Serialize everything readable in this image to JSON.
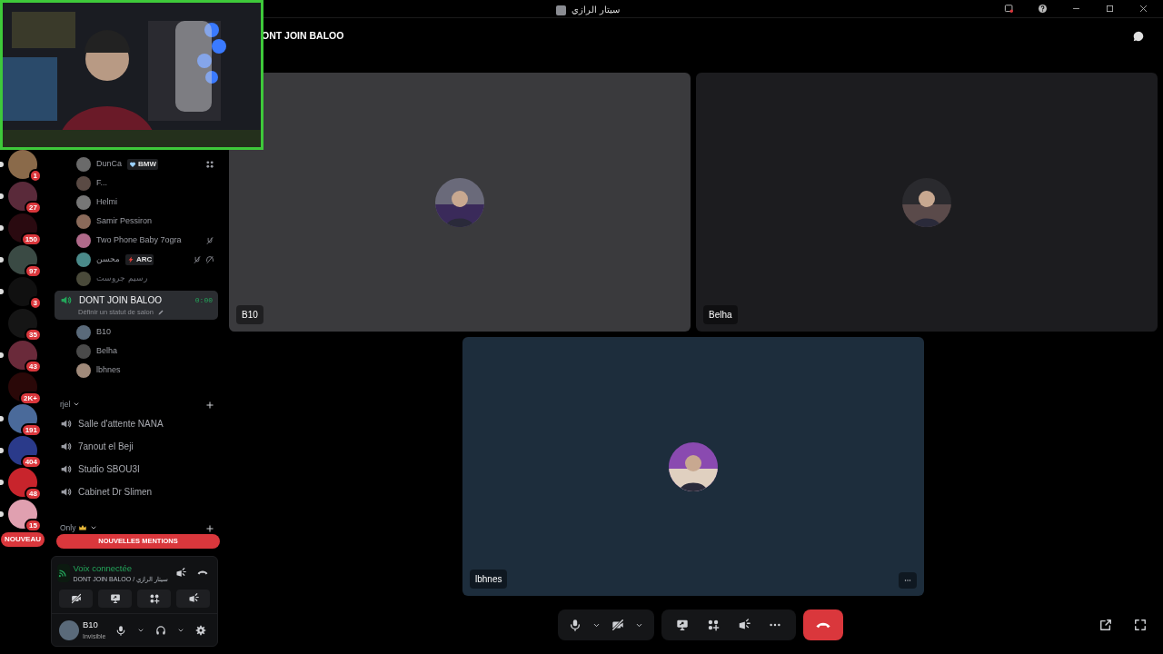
{
  "window": {
    "title": "سيتار الرازي"
  },
  "servers": [
    {
      "badge": "1",
      "color": "#8a6a4a",
      "unread": true
    },
    {
      "badge": "27",
      "color": "#5a2a3a",
      "unread": true
    },
    {
      "badge": "150",
      "color": "#2a0a10",
      "unread": true
    },
    {
      "badge": "97",
      "color": "#3a4a44",
      "unread": true
    },
    {
      "badge": "3",
      "color": "#101010",
      "unread": true
    },
    {
      "badge": "35",
      "color": "#151515",
      "unread": false
    },
    {
      "badge": "43",
      "color": "#6a2a3a",
      "unread": true
    },
    {
      "badge": "2K+",
      "color": "#2a0808",
      "unread": false
    },
    {
      "badge": "191",
      "color": "#4a6a9a",
      "unread": true
    },
    {
      "badge": "404",
      "color": "#2a3a8a",
      "unread": true
    },
    {
      "badge": "48",
      "color": "#c8242c",
      "unread": true
    },
    {
      "badge": "15",
      "color": "#e0a0b0",
      "unread": true
    }
  ],
  "new_badge": "NOUVEAU",
  "voice_members": [
    {
      "name": "DunCa",
      "tag": {
        "text": "BMW",
        "kind": "heart"
      },
      "activity": true,
      "dimmed": false
    },
    {
      "name": "F...",
      "dimmed": false
    },
    {
      "name": "Helmi",
      "dimmed": false
    },
    {
      "name": "Samir Pessiron",
      "dimmed": false
    },
    {
      "name": "Two Phone Baby 7ogra",
      "muted": true,
      "dimmed": false
    },
    {
      "name": "محسن",
      "tag": {
        "text": "ARC",
        "kind": "bolt"
      },
      "muted": true,
      "deafened": true,
      "dimmed": false
    },
    {
      "name": "رسيم جروست",
      "dimmed": true
    }
  ],
  "active_channel": {
    "name": "DONT JOIN BALOO",
    "timer": "0:00",
    "status": "Définir un statut de salon",
    "selected": true,
    "members": [
      "B10",
      "Belha",
      "lbhnes"
    ]
  },
  "categories": [
    {
      "name": "rjel",
      "channels": [
        "Salle d'attente NANA",
        "7anout el Beji",
        "Studio SBOU3I",
        "Cabinet Dr Slimen"
      ]
    },
    {
      "name": "Only",
      "crown": true
    }
  ],
  "mentions_banner": "NOUVELLES MENTIONS",
  "voice_panel": {
    "status": "Voix connectée",
    "location": "DONT JOIN BALOO / سيتار الرازي"
  },
  "user": {
    "name": "B10",
    "status": "Invisible"
  },
  "header": {
    "channel": "ONT JOIN BALOO"
  },
  "tiles": [
    {
      "name": "B10",
      "color": "#3a3a3d",
      "menu": false
    },
    {
      "name": "Belha",
      "color": "#1c1c1f",
      "menu": false
    },
    {
      "name": "lbhnes",
      "color": "#1d2d3c",
      "menu": true
    }
  ]
}
